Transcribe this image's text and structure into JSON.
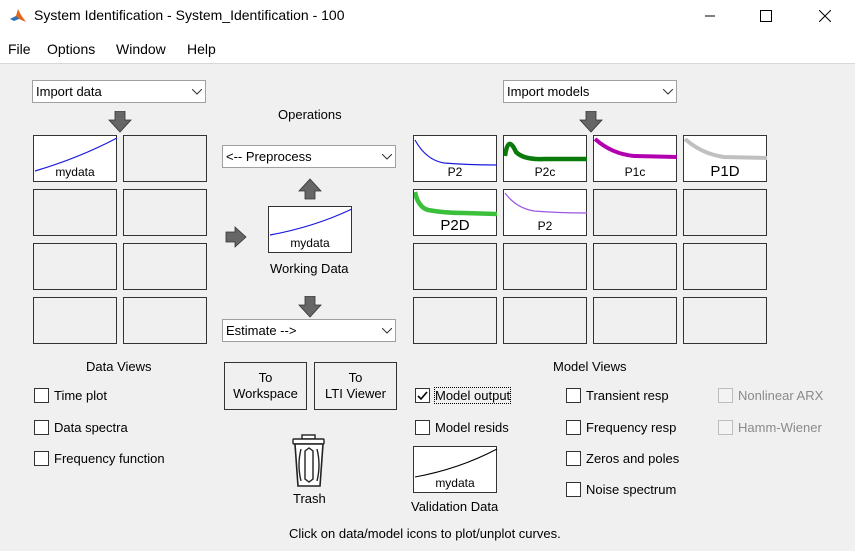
{
  "window": {
    "title": "System Identification - System_Identification - 100",
    "app_icon": "matlab-icon",
    "controls": [
      "minimize-icon",
      "maximize-icon",
      "close-icon"
    ]
  },
  "menu": [
    "File",
    "Options",
    "Window",
    "Help"
  ],
  "import_data": {
    "selected": "Import data"
  },
  "import_models": {
    "selected": "Import models"
  },
  "operations": {
    "label": "Operations",
    "preprocess": "<-- Preprocess",
    "estimate": "Estimate -->",
    "working_data_label": "Working Data",
    "working_data_name": "mydata"
  },
  "data_board": {
    "tiles": [
      "mydata",
      "",
      "",
      "",
      "",
      "",
      "",
      ""
    ]
  },
  "model_board": {
    "tiles": [
      {
        "label": "P2",
        "color": "#1a1adf"
      },
      {
        "label": "P2c",
        "color": "#0a7a0a"
      },
      {
        "label": "P1c",
        "color": "#b000b0"
      },
      {
        "label": "P1D",
        "color": "#c0c0c0"
      },
      {
        "label": "P2D",
        "color": "#3cc03c"
      },
      {
        "label": "P2",
        "color": "#9b59e0"
      }
    ]
  },
  "data_views": {
    "title": "Data Views",
    "options": [
      {
        "label": "Time plot",
        "checked": false
      },
      {
        "label": "Data spectra",
        "checked": false
      },
      {
        "label": "Frequency function",
        "checked": false
      }
    ]
  },
  "buttons": {
    "to_workspace": [
      "To",
      "Workspace"
    ],
    "to_lti": [
      "To",
      "LTI Viewer"
    ]
  },
  "trash_label": "Trash",
  "validation": {
    "name": "mydata",
    "label": "Validation Data"
  },
  "model_views": {
    "title": "Model Views",
    "col1": [
      {
        "label": "Model output",
        "checked": true
      },
      {
        "label": "Model resids",
        "checked": false
      }
    ],
    "col2": [
      {
        "label": "Transient resp",
        "checked": false
      },
      {
        "label": "Frequency resp",
        "checked": false
      },
      {
        "label": "Zeros and poles",
        "checked": false
      },
      {
        "label": "Noise spectrum",
        "checked": false
      }
    ],
    "col3": [
      {
        "label": "Nonlinear ARX",
        "checked": false
      },
      {
        "label": "Hamm-Wiener",
        "checked": false
      }
    ]
  },
  "status": "Click on data/model icons to plot/unplot curves."
}
